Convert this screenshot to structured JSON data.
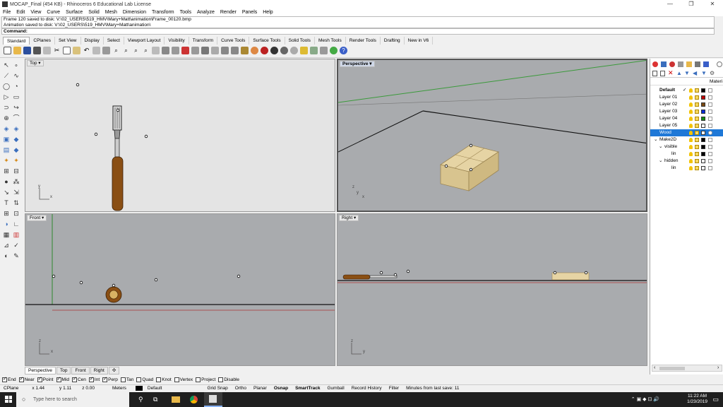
{
  "window": {
    "title": "MOCAP_Final (454 KB) - Rhinoceros 6 Educational Lab License",
    "minimize": "—",
    "restore": "❐",
    "close": "✕"
  },
  "menu": [
    "File",
    "Edit",
    "View",
    "Curve",
    "Surface",
    "Solid",
    "Mesh",
    "Dimension",
    "Transform",
    "Tools",
    "Analyze",
    "Render",
    "Panels",
    "Help"
  ],
  "history": [
    "Frame 120 saved to disk: V:\\02_USERS\\519_HMV\\Mary+Matt\\animation\\Frame_00120.bmp",
    "Animation saved to disk: V:\\02_USERS\\519_HMV\\Mary+Matt\\animation\\"
  ],
  "command_label": "Command:",
  "tabs": [
    "Standard",
    "CPlanes",
    "Set View",
    "Display",
    "Select",
    "Viewport Layout",
    "Visibility",
    "Transform",
    "Curve Tools",
    "Surface Tools",
    "Solid Tools",
    "Mesh Tools",
    "Render Tools",
    "Drafting",
    "New in V6"
  ],
  "viewports": {
    "top": {
      "label": "Top",
      "axis_y": "y",
      "axis_x": "x"
    },
    "perspective": {
      "label": "Perspective",
      "axis_y": "y",
      "axis_x": "x",
      "axis_z": "z"
    },
    "front": {
      "label": "Front",
      "axis_z": "z",
      "axis_x": "x"
    },
    "right": {
      "label": "Right",
      "axis_z": "z",
      "axis_y": "y"
    }
  },
  "viewport_tabs": [
    "Perspective",
    "Top",
    "Front",
    "Right",
    "✣"
  ],
  "layers": {
    "header_material": "Materi",
    "rows": [
      {
        "name": "Default",
        "check": "✓",
        "color": "#000000",
        "bold": true,
        "indent": 13
      },
      {
        "name": "Layer 01",
        "check": "",
        "color": "#c00000",
        "indent": 13
      },
      {
        "name": "Layer 02",
        "check": "",
        "color": "#7b4a12",
        "indent": 13
      },
      {
        "name": "Layer 03",
        "check": "",
        "color": "#0a2bd8",
        "indent": 13
      },
      {
        "name": "Layer 04",
        "check": "",
        "color": "#138a13",
        "indent": 13
      },
      {
        "name": "Layer 05",
        "check": "",
        "color": "#ffffff",
        "indent": 13
      },
      {
        "name": "Wood",
        "check": "",
        "color": "#ffffff",
        "selected": true,
        "indent": 13
      },
      {
        "name": "Make2D",
        "check": "",
        "color": "#000000",
        "indent": 13,
        "expander": "⌄"
      },
      {
        "name": "visible",
        "check": "",
        "color": "#000000",
        "indent": 20,
        "expander": "⌄"
      },
      {
        "name": "lin",
        "check": "",
        "color": "#000000",
        "indent": 30
      },
      {
        "name": "hidden",
        "check": "",
        "color": "#ffffff",
        "indent": 20,
        "expander": "⌄"
      },
      {
        "name": "lin",
        "check": "",
        "color": "#ffffff",
        "indent": 30
      }
    ]
  },
  "osnaps": [
    {
      "label": "End",
      "on": true
    },
    {
      "label": "Near",
      "on": true
    },
    {
      "label": "Point",
      "on": true
    },
    {
      "label": "Mid",
      "on": true
    },
    {
      "label": "Cen",
      "on": true
    },
    {
      "label": "Int",
      "on": true
    },
    {
      "label": "Perp",
      "on": true
    },
    {
      "label": "Tan",
      "on": false
    },
    {
      "label": "Quad",
      "on": false
    },
    {
      "label": "Knot",
      "on": false
    },
    {
      "label": "Vertex",
      "on": false
    },
    {
      "label": "Project",
      "on": false
    },
    {
      "label": "Disable",
      "on": false
    }
  ],
  "status": {
    "cplane": "CPlane",
    "x": "x 1.44",
    "y": "y 1.11",
    "z": "z 0.00",
    "units": "Meters",
    "layer": "Default",
    "grid_snap": "Grid Snap",
    "ortho": "Ortho",
    "planar": "Planar",
    "osnap": "Osnap",
    "smarttrack": "SmartTrack",
    "gumball": "Gumball",
    "record_history": "Record History",
    "filter": "Filter",
    "autosave": "Minutes from last save: 11"
  },
  "taskbar": {
    "search_placeholder": "Type here to search",
    "time": "11:22 AM",
    "date": "1/23/2019"
  },
  "colors": {
    "accent": "#1e78d7",
    "wood": "#e2cf9e",
    "handle": "#8a4f14",
    "grid_line": "#5a5a5a"
  }
}
